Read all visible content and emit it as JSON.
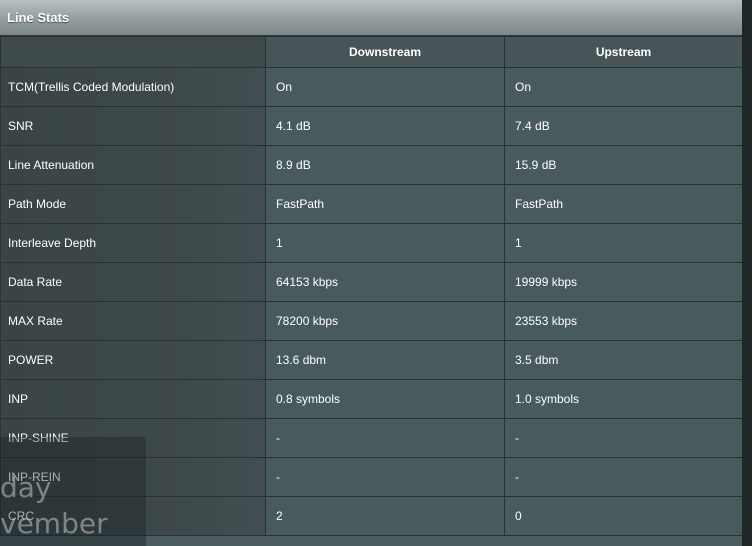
{
  "panel": {
    "title": "Line Stats"
  },
  "table": {
    "columns": [
      "",
      "Downstream",
      "Upstream"
    ],
    "rows": [
      {
        "label": "TCM(Trellis Coded Modulation)",
        "downstream": "On",
        "upstream": "On"
      },
      {
        "label": "SNR",
        "downstream": "4.1 dB",
        "upstream": "7.4 dB"
      },
      {
        "label": "Line Attenuation",
        "downstream": "8.9 dB",
        "upstream": "15.9 dB"
      },
      {
        "label": "Path Mode",
        "downstream": "FastPath",
        "upstream": "FastPath"
      },
      {
        "label": "Interleave Depth",
        "downstream": "1",
        "upstream": "1"
      },
      {
        "label": "Data Rate",
        "downstream": "64153 kbps",
        "upstream": "19999 kbps"
      },
      {
        "label": "MAX Rate",
        "downstream": "78200 kbps",
        "upstream": "23553 kbps"
      },
      {
        "label": "POWER",
        "downstream": "13.6 dbm",
        "upstream": "3.5 dbm"
      },
      {
        "label": "INP",
        "downstream": "0.8 symbols",
        "upstream": "1.0 symbols"
      },
      {
        "label": "INP-SHINE",
        "downstream": "-",
        "upstream": "-"
      },
      {
        "label": "INP-REIN",
        "downstream": "-",
        "upstream": "-"
      },
      {
        "label": "CRC",
        "downstream": "2",
        "upstream": "0"
      }
    ]
  },
  "overlay": {
    "line1": "day",
    "line2": "vember"
  }
}
